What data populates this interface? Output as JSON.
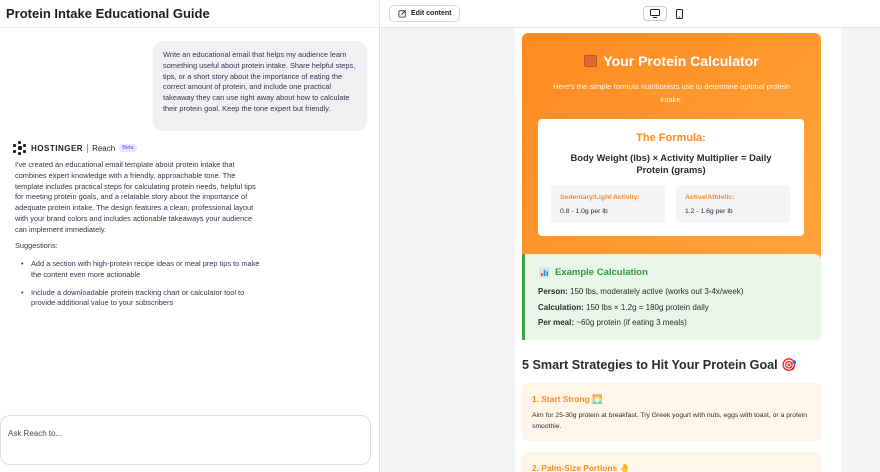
{
  "left": {
    "title": "Protein Intake Educational Guide",
    "user_message": "Write an educational email that helps my audience learn something useful about protein intake. Share helpful steps, tips, or a short story about the importance of eating the correct amount of protein, and include one practical takeaway they can use right away about how to calculate their protein goal. Keep the tone expert but friendly.",
    "brand": {
      "name": "HOSTINGER",
      "product": "Reach",
      "badge": "Beta"
    },
    "assistant_message": "I've created an educational email template about protein intake that combines expert knowledge with a friendly, approachable tone. The template includes practical steps for calculating protein needs, helpful tips for meeting protein goals, and a relatable story about the importance of adequate protein intake. The design features a clean, professional layout with your brand colors and includes actionable takeaways your audience can implement immediately.",
    "suggestions_label": "Suggestions:",
    "suggestions": [
      "Add a section with high-protein recipe ideas or meal prep tips to make the content even more actionable",
      "Include a downloadable protein tracking chart or calculator tool to provide additional value to your subscribers"
    ],
    "input_placeholder": "Ask Reach to..."
  },
  "toolbar": {
    "edit_label": "Edit content",
    "desktop_icon": "desktop-icon",
    "mobile_icon": "mobile-icon"
  },
  "email": {
    "calculator": {
      "title": "Your Protein Calculator",
      "icon": "abacus-icon",
      "subtitle": "Here's the simple formula nutritionists use to determine optimal protein intake.",
      "formula_label": "The Formula:",
      "formula": "Body Weight (lbs) × Activity Multiplier = Daily Protein (grams)",
      "activities": [
        {
          "label": "Sedentary/Light Activity:",
          "value": "0.8 - 1.0g per lb"
        },
        {
          "label": "Active/Athletic:",
          "value": "1.2 - 1.6g per lb"
        }
      ]
    },
    "example": {
      "icon": "bar-chart-icon",
      "title": "Example Calculation",
      "lines": [
        {
          "label": "Person:",
          "value": "150 lbs, moderately active (works out 3-4x/week)"
        },
        {
          "label": "Calculation:",
          "value": "150 lbs × 1.2g = 180g protein daily"
        },
        {
          "label": "Per meal:",
          "value": "~60g protein (if eating 3 meals)"
        }
      ]
    },
    "strategies_title": "5 Smart Strategies to Hit Your Protein Goal 🎯",
    "strategies": [
      {
        "title": "1. Start Strong 🌅",
        "body": "Aim for 25-30g protein at breakfast. Try Greek yogurt with nuts, eggs with toast, or a protein smoothie."
      },
      {
        "title": "2. Palm-Size Portions 🤚",
        "body": ""
      }
    ]
  },
  "colors": {
    "accent_orange": "#ff8a1f",
    "example_green": "#2e9a3b",
    "example_bg": "#e9f6ea",
    "strategy_bg": "#fff6e9",
    "brand_purple": "#673de6"
  }
}
